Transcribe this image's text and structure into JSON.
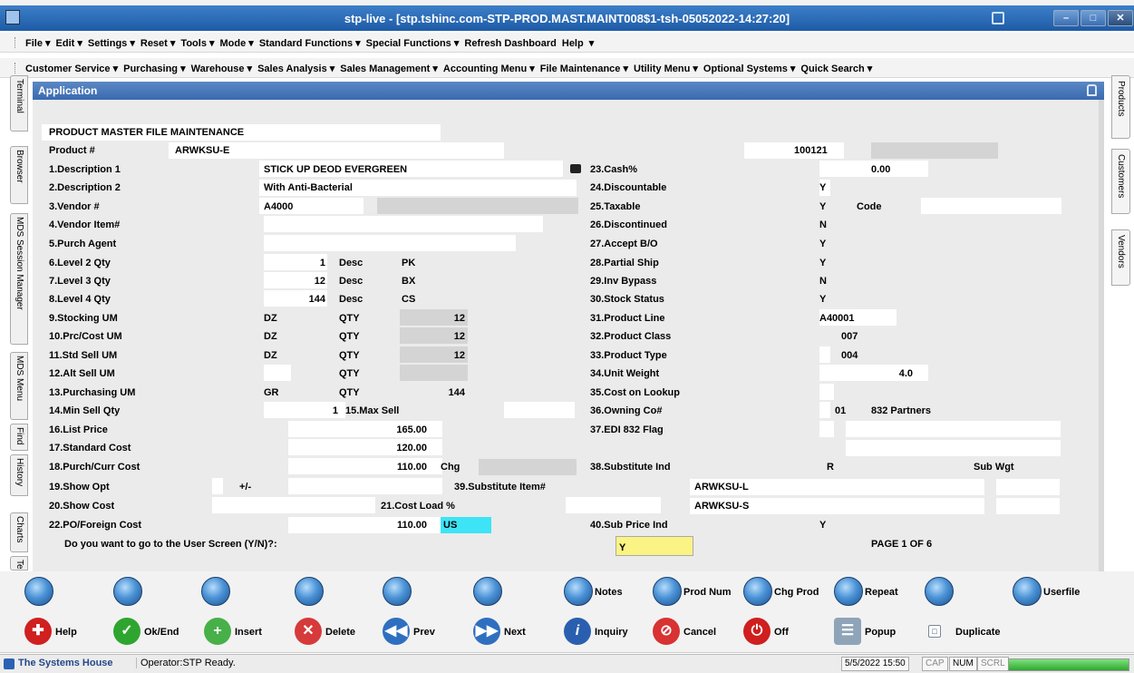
{
  "window": {
    "title": "stp-live - [stp.tshinc.com-STP-PROD.MAST.MAINT008$1-tsh-05052022-14:27:20]"
  },
  "menus": {
    "row1": [
      "File ▾",
      "Edit ▾",
      "Settings ▾",
      "Reset ▾",
      "Tools ▾",
      "Mode ▾",
      "Standard Functions ▾",
      "Special Functions ▾",
      "Refresh Dashboard",
      "Help",
      "▾"
    ],
    "row2": [
      "Customer Service ▾",
      "Purchasing ▾",
      "Warehouse ▾",
      "Sales Analysis ▾",
      "Sales Management ▾",
      "Accounting Menu ▾",
      "File Maintenance ▾",
      "Utility Menu ▾",
      "Optional Systems ▾",
      "Quick Search ▾"
    ]
  },
  "left_tabs": [
    "Terminal",
    "Browser",
    "MDS Session Manager",
    "MDS Menu",
    "Find",
    "History",
    "Charts",
    "Te"
  ],
  "right_tabs": [
    "Products",
    "Customers",
    "Vendors"
  ],
  "app_header": {
    "title": "Application"
  },
  "form": {
    "title": "PRODUCT MASTER FILE MAINTENANCE",
    "product_label": "Product #",
    "product_value": "ARWKSU-E",
    "product_code": "100121",
    "f1_label": "1.Description 1",
    "f1_value": "STICK UP DEOD EVERGREEN",
    "f2_label": "2.Description 2",
    "f2_value": "With Anti-Bacterial",
    "f3_label": "3.Vendor #",
    "f3_value": "A4000",
    "f4_label": "4.Vendor Item#",
    "f5_label": "5.Purch Agent",
    "f6_label": "6.Level 2 Qty",
    "f6_qty": "1",
    "f6_desc_label": "Desc",
    "f6_desc": "PK",
    "f7_label": "7.Level 3 Qty",
    "f7_qty": "12",
    "f7_desc_label": "Desc",
    "f7_desc": "BX",
    "f8_label": "8.Level 4 Qty",
    "f8_qty": "144",
    "f8_desc_label": "Desc",
    "f8_desc": "CS",
    "f9_label": "9.Stocking UM",
    "f9_um": "DZ",
    "f9_qty_label": "QTY",
    "f9_qty": "12",
    "f10_label": "10.Prc/Cost UM",
    "f10_um": "DZ",
    "f10_qty_label": "QTY",
    "f10_qty": "12",
    "f11_label": "11.Std Sell UM",
    "f11_um": "DZ",
    "f11_qty_label": "QTY",
    "f11_qty": "12",
    "f12_label": "12.Alt Sell UM",
    "f12_qty_label": "QTY",
    "f13_label": "13.Purchasing UM",
    "f13_um": "GR",
    "f13_qty_label": "QTY",
    "f13_qty": "144",
    "f14_label": "14.Min Sell Qty",
    "f14_value": "1",
    "f15_label": "15.Max Sell",
    "f16_label": "16.List Price",
    "f16_value": "165.00",
    "f17_label": "17.Standard Cost",
    "f17_value": "120.00",
    "f18_label": "18.Purch/Curr Cost",
    "f18_value": "110.00",
    "f18_chg": "Chg",
    "f19_label": "19.Show Opt",
    "f19_pm": "+/-",
    "f20_label": "20.Show Cost",
    "f21_label": "21.Cost Load %",
    "f22_label": "22.PO/Foreign Cost",
    "f22_value": "110.00",
    "f22_currency": "US",
    "f23_label": "23.Cash%",
    "f23_value": "0.00",
    "f24_label": "24.Discountable",
    "f24_value": "Y",
    "f25_label": "25.Taxable",
    "f25_value": "Y",
    "f25_code_label": "Code",
    "f26_label": "26.Discontinued",
    "f26_value": "N",
    "f27_label": "27.Accept B/O",
    "f27_value": "Y",
    "f28_label": "28.Partial Ship",
    "f28_value": "Y",
    "f29_label": "29.Inv Bypass",
    "f29_value": "N",
    "f30_label": "30.Stock Status",
    "f30_value": "Y",
    "f31_label": "31.Product Line",
    "f31_value": "A40001",
    "f32_label": "32.Product Class",
    "f32_value": "007",
    "f33_label": "33.Product Type",
    "f33_value": "004",
    "f34_label": "34.Unit Weight",
    "f34_value": "4.0",
    "f35_label": "35.Cost on Lookup",
    "f36_label": "36.Owning Co#",
    "f36_value": "01",
    "f36_name": "832 Partners",
    "f37_label": "37.EDI 832 Flag",
    "f38_label": "38.Substitute Ind",
    "f38_value": "R",
    "f38_subwgt": "Sub Wgt",
    "f39_label": "39.Substitute Item#",
    "f39_value1": "ARWKSU-L",
    "f39_value2": "ARWKSU-S",
    "f40_label": "40.Sub Price Ind",
    "f40_value": "Y",
    "prompt": "Do you want to go to the User Screen (Y/N)?:",
    "prompt_value": "Y",
    "page_prefix": "PAGE",
    "page_current": "1",
    "page_of": "OF",
    "page_total": "6"
  },
  "buttons_row1": {
    "notes": "Notes",
    "prod_num": "Prod Num",
    "chg_prod": "Chg Prod",
    "repeat": "Repeat",
    "userfile": "Userfile"
  },
  "buttons_row2": {
    "help": "Help",
    "ok_end": "Ok/End",
    "insert": "Insert",
    "delete": "Delete",
    "prev": "Prev",
    "next": "Next",
    "inquiry": "Inquiry",
    "cancel": "Cancel",
    "off": "Off",
    "popup": "Popup",
    "duplicate": "Duplicate"
  },
  "status": {
    "company": "The Systems House",
    "operator": "Operator:STP Ready.",
    "datetime": "5/5/2022 15:50",
    "cap": "CAP",
    "num": "NUM",
    "scrl": "SCRL"
  }
}
